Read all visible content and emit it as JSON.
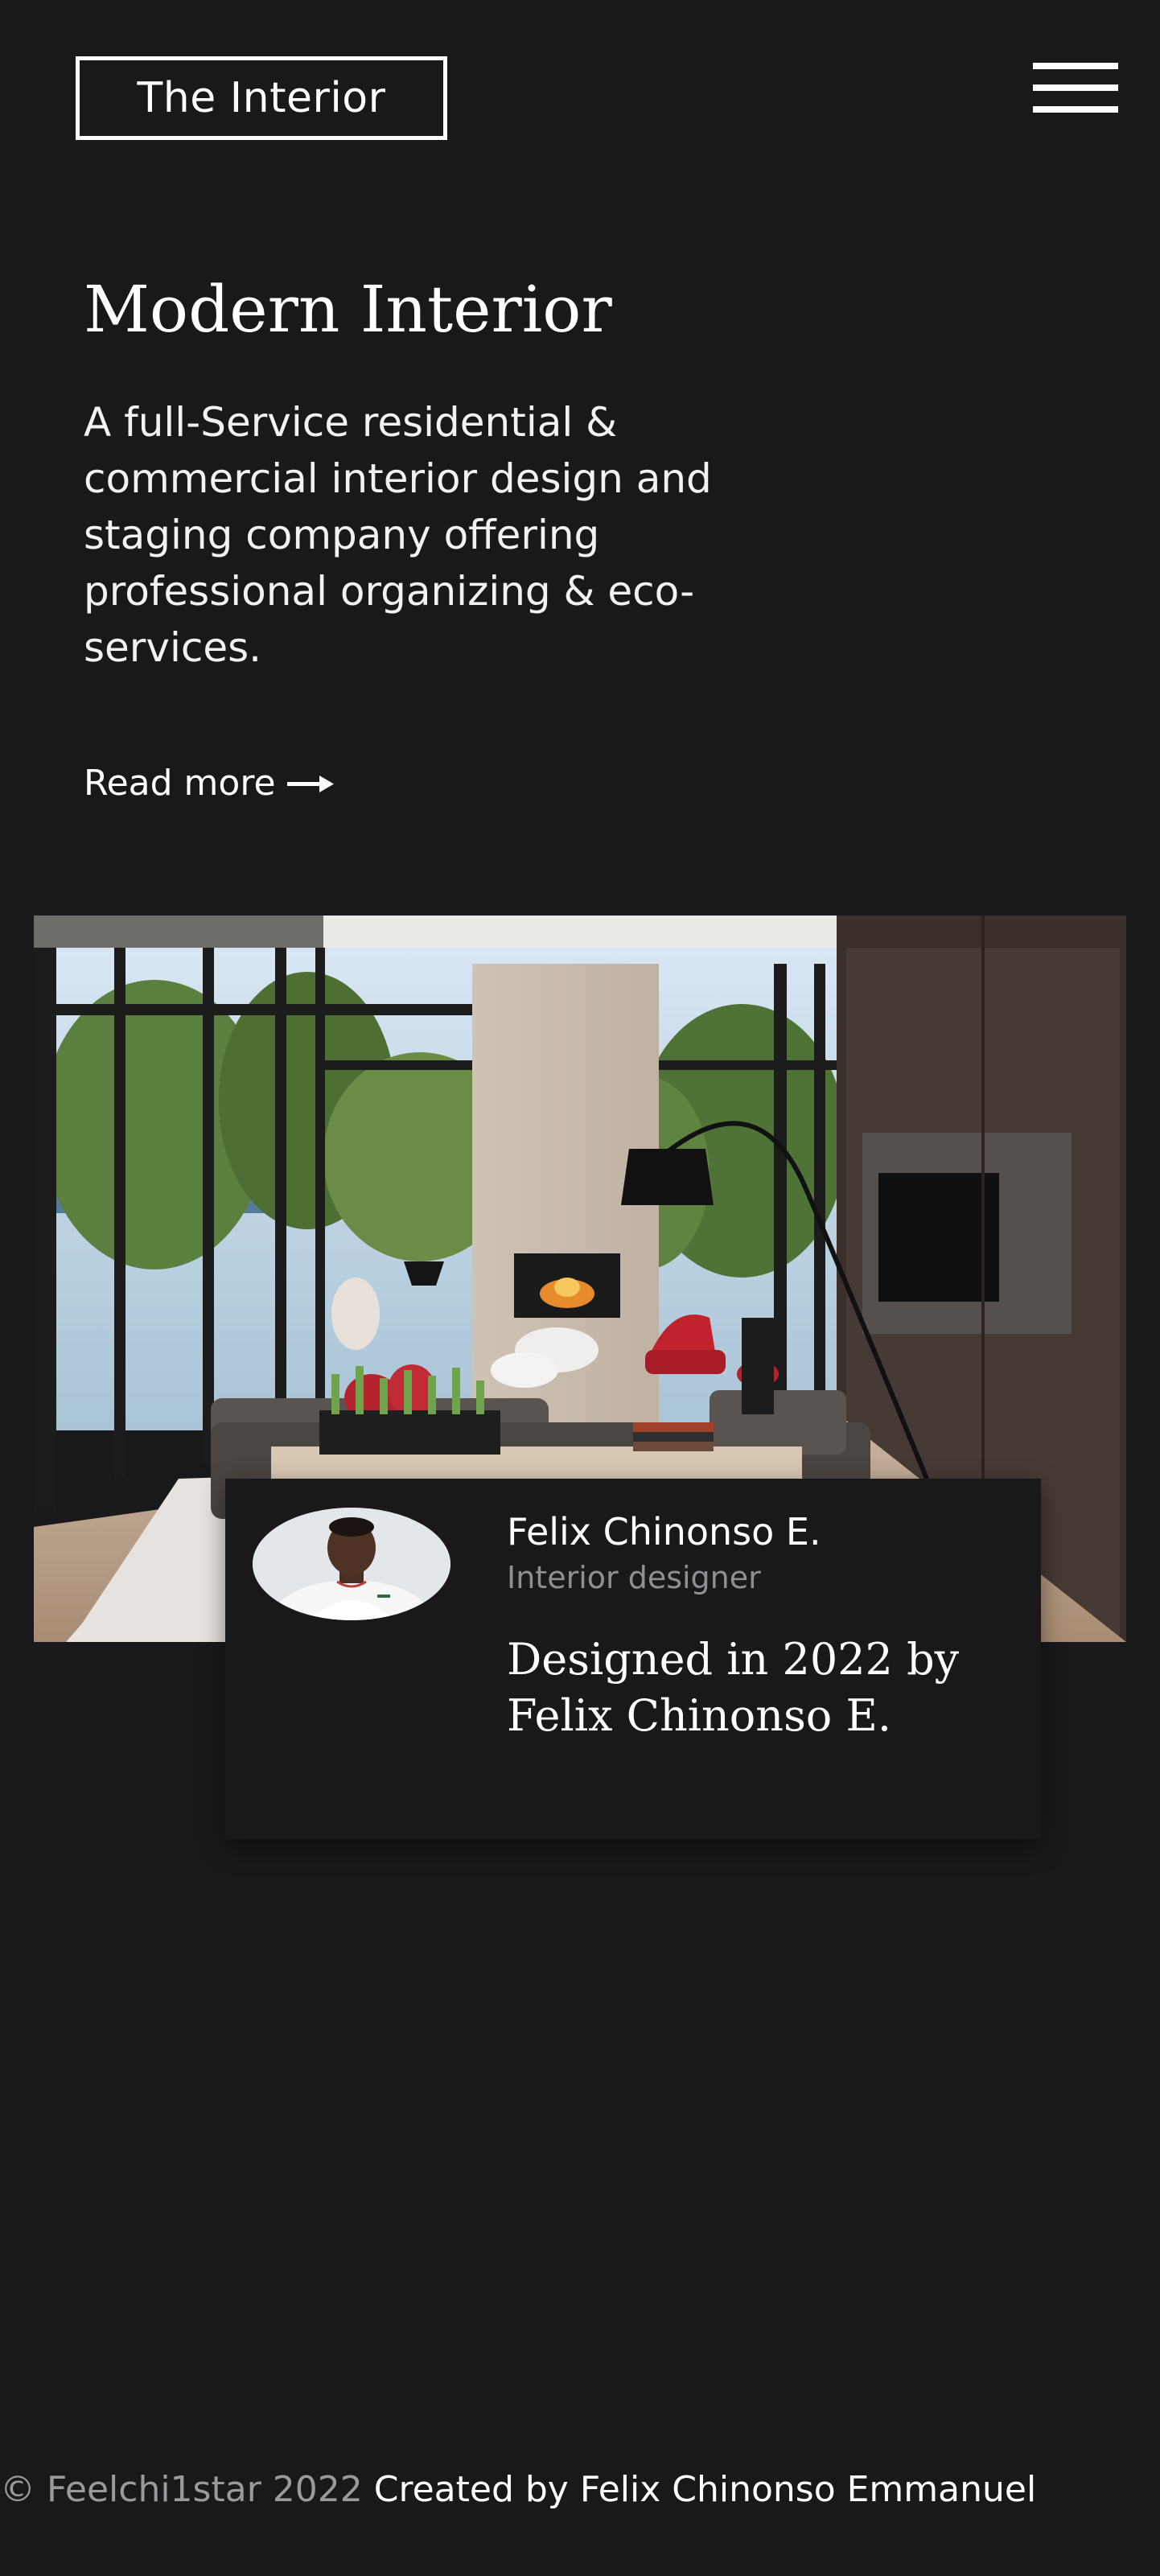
{
  "header": {
    "logo_text": "The Interior",
    "menu_icon": "hamburger-menu-icon"
  },
  "hero": {
    "title": "Modern Interior",
    "description": "A full-Service residential & commercial interior design and staging company offering professional organizing & eco-services.",
    "read_more_label": "Read more",
    "read_more_icon": "arrow-right-icon"
  },
  "showcase": {
    "image_alt": "living room with stone fireplace and floor-to-ceiling windows"
  },
  "designer_card": {
    "name": "Felix Chinonso E.",
    "role": "Interior designer",
    "designed_by": "Designed in 2022 by Felix Chinonso E."
  },
  "footer": {
    "copyright": "© Feelchi1star 2022",
    "credit": "Created by Felix Chinonso Emmanuel"
  }
}
